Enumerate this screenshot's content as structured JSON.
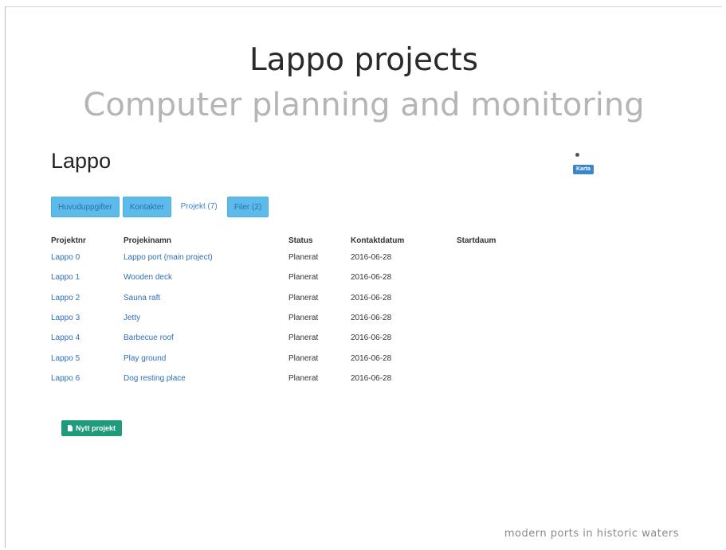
{
  "slide": {
    "title": "Lappo projects",
    "subtitle": "Computer planning and monitoring",
    "footer": "modern ports in historic waters"
  },
  "page": {
    "heading": "Lappo",
    "map_button": "Karta",
    "pin_icon": "map-pin-icon"
  },
  "tabs": [
    {
      "label": "Huvuduppgifter",
      "state": "filled"
    },
    {
      "label": "Kontakter",
      "state": "filled"
    },
    {
      "label": "Projekt (7)",
      "state": "active"
    },
    {
      "label": "Filer (2)",
      "state": "filled"
    }
  ],
  "table": {
    "headers": [
      "Projektnr",
      "Projekinamn",
      "Status",
      "Kontaktdatum",
      "Startdaum"
    ],
    "rows": [
      {
        "nr": "Lappo 0",
        "name": "Lappo port (main project)",
        "status": "Planerat",
        "date": "2016-06-28"
      },
      {
        "nr": "Lappo 1",
        "name": "Wooden deck",
        "status": "Planerat",
        "date": "2016-06-28"
      },
      {
        "nr": "Lappo 2",
        "name": "Sauna raft",
        "status": "Planerat",
        "date": "2016-06-28"
      },
      {
        "nr": "Lappo 3",
        "name": "Jetty",
        "status": "Planerat",
        "date": "2016-06-28"
      },
      {
        "nr": "Lappo 4",
        "name": "Barbecue roof",
        "status": "Planerat",
        "date": "2016-06-28"
      },
      {
        "nr": "Lappo 5",
        "name": "Play ground",
        "status": "Planerat",
        "date": "2016-06-28"
      },
      {
        "nr": "Lappo 6",
        "name": "Dog resting place",
        "status": "Planerat",
        "date": "2016-06-28"
      }
    ]
  },
  "actions": {
    "new_project": "Nytt projekt",
    "new_project_icon": "document-icon"
  },
  "colors": {
    "tab_fill": "#5cbbe8",
    "link": "#2f6fb8",
    "new_button": "#1f9a7a",
    "map_button": "#3a86cc"
  }
}
